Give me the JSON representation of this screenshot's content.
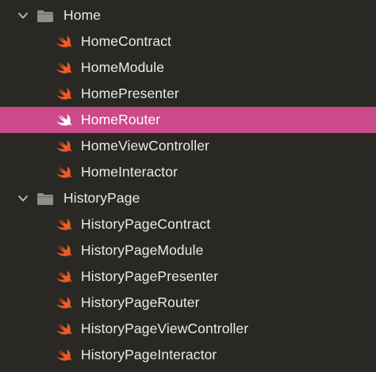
{
  "colors": {
    "background": "#2a2824",
    "selection": "#cc4a8a",
    "swift_orange": "#f05a24",
    "folder_gray": "#8e8e8c",
    "text": "#ebebe6"
  },
  "icons": {
    "folder": "folder-icon",
    "file": "swift-file-icon",
    "disclosure": "chevron-down-icon"
  },
  "groups": [
    {
      "name": "Home",
      "expanded": true,
      "files": [
        {
          "name": "HomeContract",
          "selected": false
        },
        {
          "name": "HomeModule",
          "selected": false
        },
        {
          "name": "HomePresenter",
          "selected": false
        },
        {
          "name": "HomeRouter",
          "selected": true
        },
        {
          "name": "HomeViewController",
          "selected": false
        },
        {
          "name": "HomeInteractor",
          "selected": false
        }
      ]
    },
    {
      "name": "HistoryPage",
      "expanded": true,
      "files": [
        {
          "name": "HistoryPageContract",
          "selected": false
        },
        {
          "name": "HistoryPageModule",
          "selected": false
        },
        {
          "name": "HistoryPagePresenter",
          "selected": false
        },
        {
          "name": "HistoryPageRouter",
          "selected": false
        },
        {
          "name": "HistoryPageViewController",
          "selected": false
        },
        {
          "name": "HistoryPageInteractor",
          "selected": false
        }
      ]
    }
  ]
}
